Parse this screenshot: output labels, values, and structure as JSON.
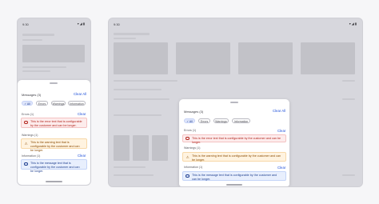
{
  "phone": {
    "time": "9:30",
    "status_icons": "▾◢▮"
  },
  "tablet": {
    "time": "9:30",
    "status_icons": "▾◢▮"
  },
  "panel": {
    "title": "Messages (3)",
    "clear_all": "Clear All",
    "filters": [
      {
        "label": "All",
        "check": "✓",
        "active": true
      },
      {
        "label": "Errors",
        "active": false
      },
      {
        "label": "Warnings",
        "active": false
      },
      {
        "label": "Information",
        "active": false
      }
    ],
    "sections": [
      {
        "kind": "err",
        "title": "Errors (1)",
        "clear": "Clear",
        "text": "This is the error text that is configurable by the customer and can be longer.",
        "icon": "error-icon"
      },
      {
        "kind": "warn",
        "title": "Warnings (1)",
        "clear": "Clear",
        "text": "This is the warning text that is configurable by the customer and can be longer.",
        "icon": "warning-icon"
      },
      {
        "kind": "info",
        "title": "Information (1)",
        "clear": "Clear",
        "text": "This is the message text that is configurable by the customer and can be longer.",
        "icon": "info-icon"
      }
    ],
    "colors": {
      "error": "#b3261e",
      "warning": "#8a4b00",
      "info": "#1d3e8f",
      "link": "#1d4fd9"
    }
  }
}
